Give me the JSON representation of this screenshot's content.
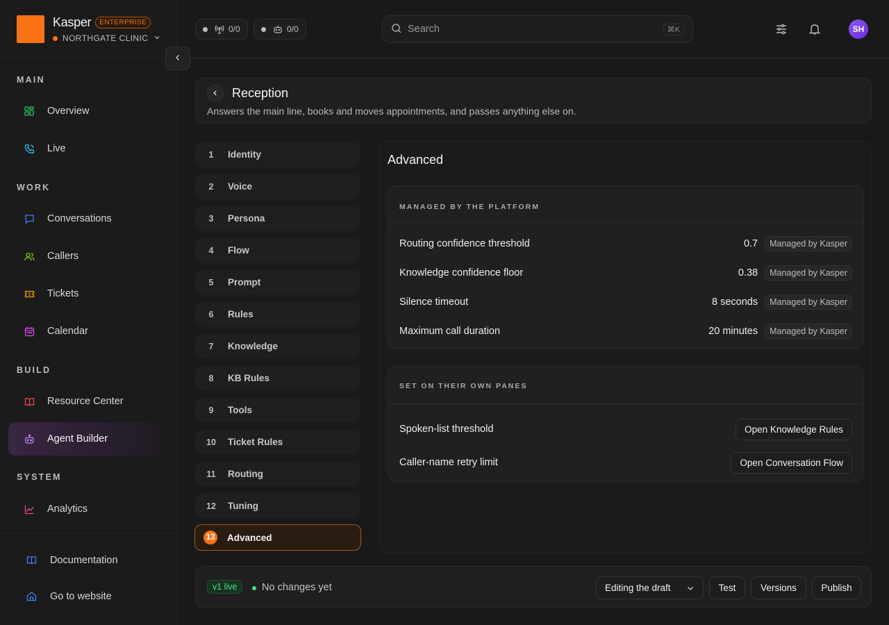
{
  "brand": {
    "name": "Kasper",
    "badge": "ENTERPRISE",
    "org": "NORTHGATE CLINIC"
  },
  "sidebar": {
    "sections": [
      "MAIN",
      "WORK",
      "BUILD",
      "SYSTEM"
    ],
    "items": [
      {
        "label": "Overview",
        "icon": "grid-icon"
      },
      {
        "label": "Live",
        "icon": "phone-icon"
      },
      {
        "label": "Conversations",
        "icon": "chat-icon"
      },
      {
        "label": "Callers",
        "icon": "users-icon"
      },
      {
        "label": "Tickets",
        "icon": "ticket-icon"
      },
      {
        "label": "Calendar",
        "icon": "calendar-icon"
      },
      {
        "label": "Resource Center",
        "icon": "book-icon"
      },
      {
        "label": "Agent Builder",
        "icon": "bot-icon"
      },
      {
        "label": "Analytics",
        "icon": "chart-icon"
      }
    ],
    "footer": [
      {
        "label": "Documentation",
        "icon": "book-open-icon"
      },
      {
        "label": "Go to website",
        "icon": "home-icon"
      }
    ]
  },
  "topbar": {
    "chip_live": "0/0",
    "chip_agents": "0/0",
    "search_placeholder": "Search",
    "search_shortcut": "⌘K",
    "avatar": "SH"
  },
  "agent": {
    "title": "Reception",
    "description": "Answers the main line, books and moves appointments, and passes anything else on."
  },
  "steps": [
    {
      "num": "1",
      "label": "Identity"
    },
    {
      "num": "2",
      "label": "Voice"
    },
    {
      "num": "3",
      "label": "Persona"
    },
    {
      "num": "4",
      "label": "Flow"
    },
    {
      "num": "5",
      "label": "Prompt"
    },
    {
      "num": "6",
      "label": "Rules"
    },
    {
      "num": "7",
      "label": "Knowledge"
    },
    {
      "num": "8",
      "label": "KB Rules"
    },
    {
      "num": "9",
      "label": "Tools"
    },
    {
      "num": "10",
      "label": "Ticket Rules"
    },
    {
      "num": "11",
      "label": "Routing"
    },
    {
      "num": "12",
      "label": "Tuning"
    },
    {
      "num": "13",
      "label": "Advanced"
    }
  ],
  "panel": {
    "title": "Advanced",
    "managed": {
      "label": "MANAGED BY THE PLATFORM",
      "badge": "Managed by Kasper",
      "rows": [
        {
          "label": "Routing confidence threshold",
          "value": "0.7"
        },
        {
          "label": "Knowledge confidence floor",
          "value": "0.38"
        },
        {
          "label": "Silence timeout",
          "value": "8 seconds"
        },
        {
          "label": "Maximum call duration",
          "value": "20 minutes"
        }
      ]
    },
    "own_panes": {
      "label": "SET ON THEIR OWN PANES",
      "rows": [
        {
          "label": "Spoken-list threshold",
          "button": "Open Knowledge Rules"
        },
        {
          "label": "Caller-name retry limit",
          "button": "Open Conversation Flow"
        }
      ]
    }
  },
  "bottom": {
    "version": "v1 live",
    "status": "No changes yet",
    "mode": "Editing the draft",
    "test": "Test",
    "versions": "Versions",
    "publish": "Publish"
  },
  "colors": {
    "accent": "#f97316",
    "active_nav": "#3a2642",
    "live_green": "#4ade80"
  }
}
